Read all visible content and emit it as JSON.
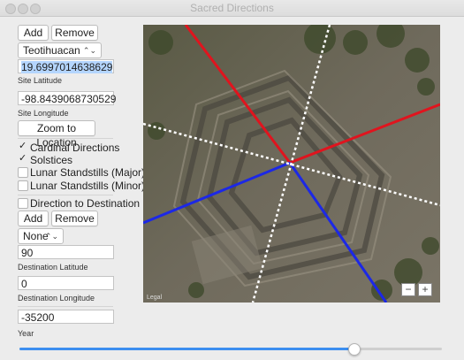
{
  "window": {
    "title": "Sacred Directions"
  },
  "sites": {
    "add_label": "Add",
    "remove_label": "Remove",
    "selected": "Teotihuacan"
  },
  "site": {
    "latitude_value": "19.6997014638629",
    "latitude_label": "Site Latitude",
    "longitude_value": "-98.8439068730529",
    "longitude_label": "Site Longitude",
    "zoom_button": "Zoom to Location"
  },
  "options": [
    {
      "label": "Cardinal Directions",
      "checked": true
    },
    {
      "label": "Solstices",
      "checked": true
    },
    {
      "label": "Lunar Standstills (Major)",
      "checked": false
    },
    {
      "label": "Lunar Standstills (Minor)",
      "checked": false
    }
  ],
  "destination": {
    "toggle_label": "Direction to Destination",
    "toggle_checked": false,
    "add_label": "Add",
    "remove_label": "Remove",
    "selected": "None",
    "latitude_value": "90",
    "latitude_label": "Destination Latitude",
    "longitude_value": "0",
    "longitude_label": "Destination Longitude"
  },
  "year": {
    "value": "-35200",
    "label": "Year",
    "slider_fraction": 0.79
  },
  "map": {
    "zoom_out": "−",
    "zoom_in": "+",
    "watermark": "Legal",
    "colors": {
      "solstice_winter": "#e0141e",
      "solstice_summer": "#1c28e6",
      "cardinal": "#ffffff"
    }
  }
}
